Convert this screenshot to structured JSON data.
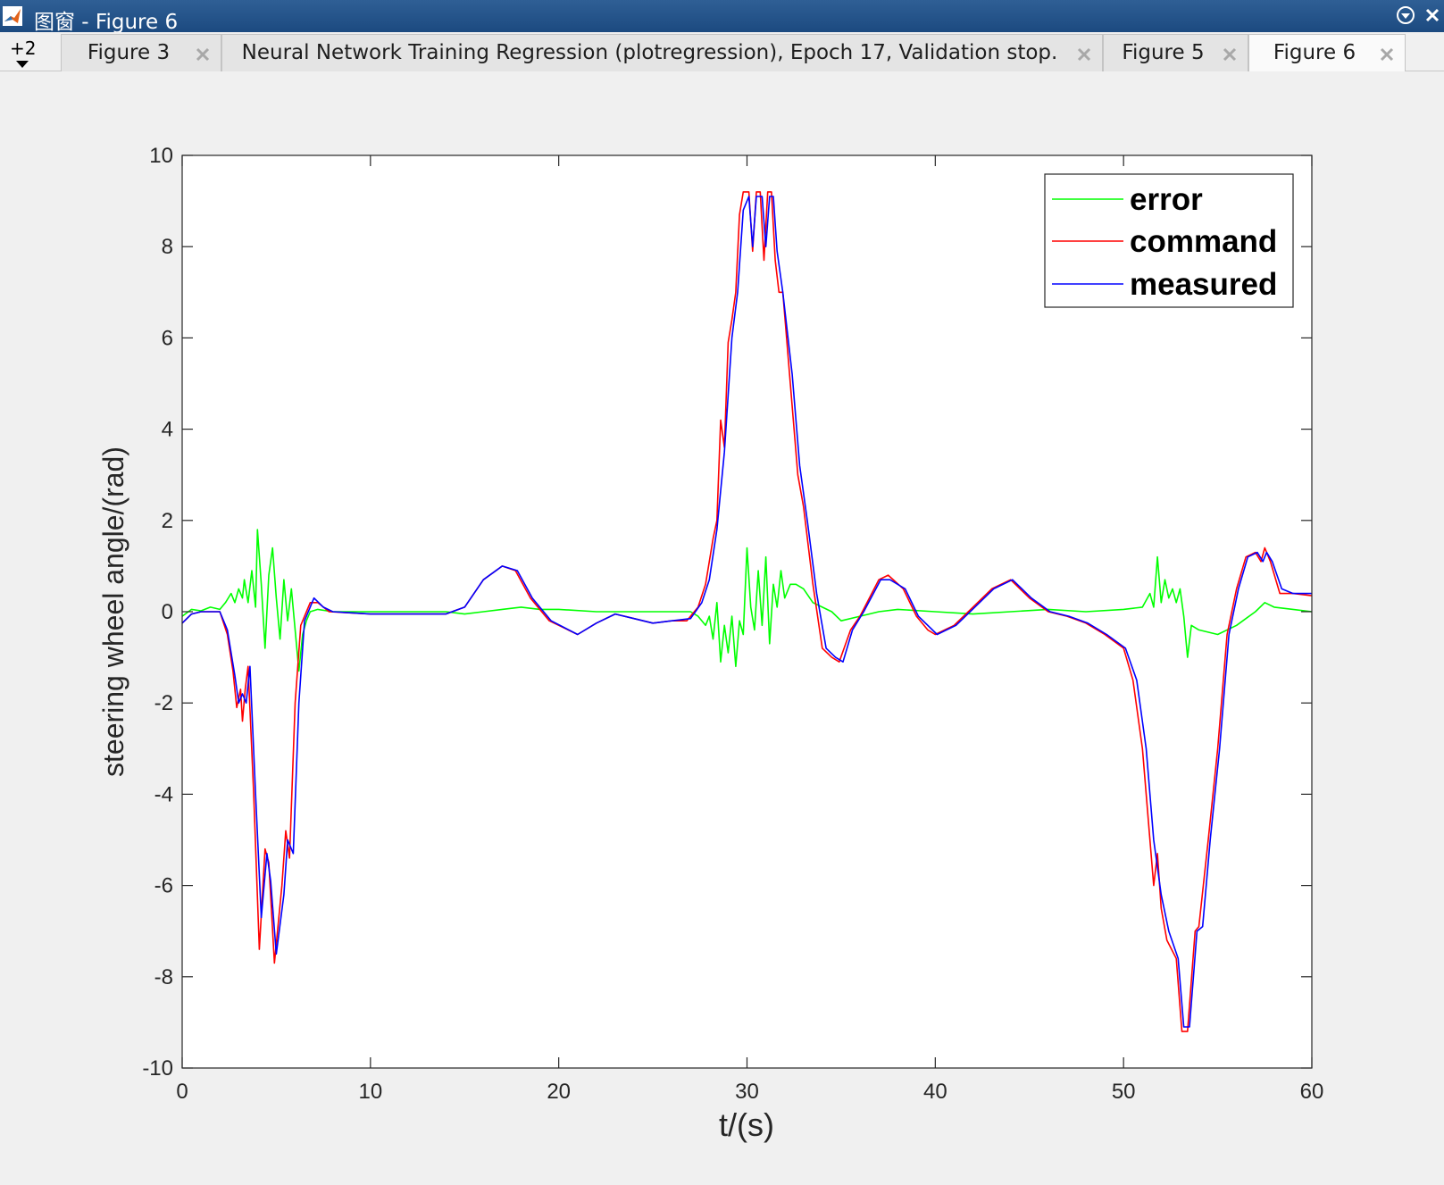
{
  "window": {
    "title": "图窗 - Figure 6",
    "controls": [
      "menu-icon",
      "close-icon"
    ]
  },
  "tabstrip": {
    "overflow_label": "+2",
    "tabs": [
      {
        "label": "Figure 3",
        "active": false
      },
      {
        "label": "Neural Network Training Regression (plotregression), Epoch 17, Validation stop.",
        "active": false
      },
      {
        "label": "Figure 5",
        "active": false
      },
      {
        "label": "Figure 6",
        "active": true
      }
    ]
  },
  "colors": {
    "error": "#00ff00",
    "command": "#ff0000",
    "measured": "#0000ff",
    "titlebar": "#1c4a80",
    "background": "#f0f0f0"
  },
  "chart_data": {
    "type": "line",
    "title": "",
    "xlabel": "t/(s)",
    "ylabel": "steering wheel angle/(rad)",
    "xlim": [
      0,
      60
    ],
    "ylim": [
      -10,
      10
    ],
    "xticks": [
      0,
      10,
      20,
      30,
      40,
      50,
      60
    ],
    "yticks": [
      10,
      8,
      6,
      4,
      2,
      0,
      -2,
      -4,
      -6,
      -8,
      -10
    ],
    "grid": false,
    "legend_position": "top-right",
    "series": [
      {
        "name": "error",
        "color": "#00ff00",
        "points": [
          [
            0,
            -0.1
          ],
          [
            0.5,
            0.05
          ],
          [
            1,
            0.02
          ],
          [
            1.5,
            0.1
          ],
          [
            2,
            0.05
          ],
          [
            2.3,
            0.2
          ],
          [
            2.6,
            0.4
          ],
          [
            2.8,
            0.2
          ],
          [
            3.0,
            0.5
          ],
          [
            3.2,
            0.3
          ],
          [
            3.3,
            0.7
          ],
          [
            3.5,
            0.2
          ],
          [
            3.7,
            0.9
          ],
          [
            3.9,
            0.1
          ],
          [
            4.0,
            1.8
          ],
          [
            4.2,
            0.6
          ],
          [
            4.4,
            -0.8
          ],
          [
            4.6,
            0.8
          ],
          [
            4.8,
            1.4
          ],
          [
            5.0,
            0.3
          ],
          [
            5.2,
            -0.6
          ],
          [
            5.4,
            0.7
          ],
          [
            5.6,
            -0.2
          ],
          [
            5.8,
            0.5
          ],
          [
            6.0,
            -0.4
          ],
          [
            6.2,
            -1.3
          ],
          [
            6.4,
            -0.5
          ],
          [
            6.6,
            -0.2
          ],
          [
            6.8,
            0.0
          ],
          [
            7.2,
            0.05
          ],
          [
            8,
            0.0
          ],
          [
            10,
            0.0
          ],
          [
            12,
            0.0
          ],
          [
            14,
            0.0
          ],
          [
            15,
            -0.05
          ],
          [
            16,
            0.0
          ],
          [
            17,
            0.05
          ],
          [
            18,
            0.1
          ],
          [
            19,
            0.05
          ],
          [
            20,
            0.05
          ],
          [
            22,
            0.0
          ],
          [
            25,
            0.0
          ],
          [
            26,
            0.0
          ],
          [
            27,
            0.0
          ],
          [
            27.4,
            -0.1
          ],
          [
            27.8,
            -0.3
          ],
          [
            28.0,
            -0.1
          ],
          [
            28.2,
            -0.6
          ],
          [
            28.4,
            0.2
          ],
          [
            28.6,
            -1.1
          ],
          [
            28.8,
            -0.3
          ],
          [
            29.0,
            -0.9
          ],
          [
            29.2,
            -0.1
          ],
          [
            29.4,
            -1.2
          ],
          [
            29.6,
            -0.2
          ],
          [
            29.8,
            -0.5
          ],
          [
            30.0,
            1.4
          ],
          [
            30.2,
            0.1
          ],
          [
            30.4,
            -0.4
          ],
          [
            30.6,
            0.9
          ],
          [
            30.8,
            -0.3
          ],
          [
            31.0,
            1.2
          ],
          [
            31.2,
            -0.7
          ],
          [
            31.4,
            0.6
          ],
          [
            31.6,
            0.1
          ],
          [
            31.8,
            0.9
          ],
          [
            32.0,
            0.3
          ],
          [
            32.3,
            0.6
          ],
          [
            32.6,
            0.6
          ],
          [
            33,
            0.5
          ],
          [
            33.5,
            0.2
          ],
          [
            34,
            0.1
          ],
          [
            34.5,
            0.0
          ],
          [
            35,
            -0.2
          ],
          [
            36,
            -0.1
          ],
          [
            37,
            0.0
          ],
          [
            38,
            0.05
          ],
          [
            40,
            0.0
          ],
          [
            42,
            -0.05
          ],
          [
            44,
            0.0
          ],
          [
            46,
            0.05
          ],
          [
            48,
            0.0
          ],
          [
            50,
            0.05
          ],
          [
            51,
            0.1
          ],
          [
            51.4,
            0.4
          ],
          [
            51.6,
            0.1
          ],
          [
            51.8,
            1.2
          ],
          [
            52.0,
            0.2
          ],
          [
            52.2,
            0.7
          ],
          [
            52.4,
            0.3
          ],
          [
            52.6,
            0.5
          ],
          [
            52.8,
            0.2
          ],
          [
            53.0,
            0.5
          ],
          [
            53.2,
            -0.1
          ],
          [
            53.4,
            -1.0
          ],
          [
            53.6,
            -0.3
          ],
          [
            54,
            -0.4
          ],
          [
            55,
            -0.5
          ],
          [
            56,
            -0.3
          ],
          [
            57,
            0.0
          ],
          [
            57.5,
            0.2
          ],
          [
            58,
            0.1
          ],
          [
            59,
            0.05
          ],
          [
            60,
            0.0
          ]
        ]
      },
      {
        "name": "command",
        "color": "#ff0000",
        "points": [
          [
            0,
            -0.25
          ],
          [
            0.5,
            -0.05
          ],
          [
            1,
            0.0
          ],
          [
            2,
            0.0
          ],
          [
            2.4,
            -0.5
          ],
          [
            2.7,
            -1.3
          ],
          [
            2.9,
            -2.1
          ],
          [
            3.1,
            -1.7
          ],
          [
            3.2,
            -2.4
          ],
          [
            3.35,
            -1.7
          ],
          [
            3.5,
            -1.2
          ],
          [
            3.8,
            -4.0
          ],
          [
            4.1,
            -7.4
          ],
          [
            4.4,
            -5.2
          ],
          [
            4.6,
            -5.5
          ],
          [
            4.9,
            -7.7
          ],
          [
            5.3,
            -6.0
          ],
          [
            5.5,
            -4.8
          ],
          [
            5.7,
            -5.4
          ],
          [
            6.0,
            -2.0
          ],
          [
            6.3,
            -0.3
          ],
          [
            6.8,
            0.2
          ],
          [
            7.2,
            0.2
          ],
          [
            7.8,
            0.0
          ],
          [
            10,
            -0.05
          ],
          [
            12,
            -0.05
          ],
          [
            14,
            -0.05
          ],
          [
            15,
            0.1
          ],
          [
            16,
            0.7
          ],
          [
            17,
            1.0
          ],
          [
            17.7,
            0.9
          ],
          [
            18.5,
            0.3
          ],
          [
            19.5,
            -0.2
          ],
          [
            21,
            -0.5
          ],
          [
            22,
            -0.25
          ],
          [
            23,
            -0.05
          ],
          [
            24,
            -0.15
          ],
          [
            25,
            -0.25
          ],
          [
            26,
            -0.2
          ],
          [
            26.8,
            -0.2
          ],
          [
            27.4,
            0.1
          ],
          [
            27.8,
            0.6
          ],
          [
            28.2,
            1.6
          ],
          [
            28.4,
            2.0
          ],
          [
            28.6,
            4.2
          ],
          [
            28.8,
            3.6
          ],
          [
            29.0,
            5.9
          ],
          [
            29.2,
            6.4
          ],
          [
            29.4,
            7.0
          ],
          [
            29.6,
            8.7
          ],
          [
            29.8,
            9.2
          ],
          [
            30.1,
            9.2
          ],
          [
            30.3,
            7.9
          ],
          [
            30.5,
            9.2
          ],
          [
            30.7,
            9.2
          ],
          [
            30.9,
            7.7
          ],
          [
            31.1,
            9.2
          ],
          [
            31.3,
            9.2
          ],
          [
            31.5,
            7.7
          ],
          [
            31.7,
            7.0
          ],
          [
            31.9,
            7.0
          ],
          [
            32.3,
            5.0
          ],
          [
            32.7,
            3.0
          ],
          [
            33.0,
            2.3
          ],
          [
            33.5,
            0.6
          ],
          [
            34.0,
            -0.8
          ],
          [
            34.5,
            -1.0
          ],
          [
            34.9,
            -1.1
          ],
          [
            35.5,
            -0.4
          ],
          [
            36,
            -0.1
          ],
          [
            37,
            0.7
          ],
          [
            37.5,
            0.8
          ],
          [
            38.3,
            0.5
          ],
          [
            39,
            -0.1
          ],
          [
            39.6,
            -0.4
          ],
          [
            40,
            -0.5
          ],
          [
            41,
            -0.3
          ],
          [
            42,
            0.1
          ],
          [
            43,
            0.5
          ],
          [
            44,
            0.7
          ],
          [
            45,
            0.3
          ],
          [
            46,
            0.0
          ],
          [
            47,
            -0.1
          ],
          [
            48,
            -0.25
          ],
          [
            49,
            -0.5
          ],
          [
            50,
            -0.8
          ],
          [
            50.5,
            -1.5
          ],
          [
            51,
            -3.0
          ],
          [
            51.4,
            -5.0
          ],
          [
            51.6,
            -6.0
          ],
          [
            51.8,
            -5.3
          ],
          [
            52.0,
            -6.5
          ],
          [
            52.3,
            -7.2
          ],
          [
            52.8,
            -7.6
          ],
          [
            53.1,
            -9.2
          ],
          [
            53.4,
            -9.2
          ],
          [
            53.8,
            -7.0
          ],
          [
            54,
            -6.9
          ],
          [
            54.5,
            -5.0
          ],
          [
            55,
            -3.0
          ],
          [
            55.5,
            -0.5
          ],
          [
            56,
            0.5
          ],
          [
            56.5,
            1.2
          ],
          [
            57,
            1.3
          ],
          [
            57.3,
            1.1
          ],
          [
            57.5,
            1.4
          ],
          [
            57.8,
            1.1
          ],
          [
            58.3,
            0.4
          ],
          [
            59,
            0.4
          ],
          [
            60,
            0.35
          ]
        ]
      },
      {
        "name": "measured",
        "color": "#0000ff",
        "points": [
          [
            0,
            -0.25
          ],
          [
            0.5,
            -0.05
          ],
          [
            1,
            0.0
          ],
          [
            2,
            0.0
          ],
          [
            2.4,
            -0.4
          ],
          [
            2.8,
            -1.4
          ],
          [
            3.0,
            -2.0
          ],
          [
            3.2,
            -1.8
          ],
          [
            3.4,
            -2.0
          ],
          [
            3.6,
            -1.2
          ],
          [
            3.9,
            -4.0
          ],
          [
            4.2,
            -6.7
          ],
          [
            4.5,
            -5.3
          ],
          [
            4.7,
            -5.9
          ],
          [
            5.0,
            -7.5
          ],
          [
            5.4,
            -6.2
          ],
          [
            5.6,
            -5.0
          ],
          [
            5.9,
            -5.3
          ],
          [
            6.2,
            -2.0
          ],
          [
            6.5,
            -0.2
          ],
          [
            7.0,
            0.3
          ],
          [
            7.5,
            0.1
          ],
          [
            8,
            0.0
          ],
          [
            10,
            -0.05
          ],
          [
            14,
            -0.05
          ],
          [
            15,
            0.1
          ],
          [
            16,
            0.7
          ],
          [
            17,
            1.0
          ],
          [
            17.8,
            0.9
          ],
          [
            18.6,
            0.3
          ],
          [
            19.6,
            -0.2
          ],
          [
            21,
            -0.5
          ],
          [
            22,
            -0.25
          ],
          [
            23,
            -0.05
          ],
          [
            24,
            -0.15
          ],
          [
            25,
            -0.25
          ],
          [
            26,
            -0.2
          ],
          [
            27,
            -0.15
          ],
          [
            27.6,
            0.2
          ],
          [
            28.0,
            0.7
          ],
          [
            28.4,
            1.8
          ],
          [
            28.8,
            3.5
          ],
          [
            29.2,
            6.0
          ],
          [
            29.5,
            7.0
          ],
          [
            29.8,
            8.8
          ],
          [
            30.1,
            9.1
          ],
          [
            30.3,
            8.0
          ],
          [
            30.5,
            9.1
          ],
          [
            30.8,
            9.1
          ],
          [
            31.0,
            8.0
          ],
          [
            31.2,
            9.1
          ],
          [
            31.4,
            9.1
          ],
          [
            31.6,
            7.9
          ],
          [
            31.9,
            7.0
          ],
          [
            32.4,
            5.2
          ],
          [
            32.8,
            3.2
          ],
          [
            33.2,
            2.0
          ],
          [
            33.7,
            0.4
          ],
          [
            34.2,
            -0.8
          ],
          [
            34.7,
            -1.0
          ],
          [
            35.1,
            -1.1
          ],
          [
            35.6,
            -0.4
          ],
          [
            36.2,
            0.0
          ],
          [
            37.1,
            0.7
          ],
          [
            37.6,
            0.7
          ],
          [
            38.4,
            0.5
          ],
          [
            39.1,
            -0.1
          ],
          [
            40.1,
            -0.5
          ],
          [
            41.1,
            -0.3
          ],
          [
            42.1,
            0.1
          ],
          [
            43.1,
            0.5
          ],
          [
            44.1,
            0.7
          ],
          [
            45.1,
            0.3
          ],
          [
            46.1,
            0.0
          ],
          [
            47.1,
            -0.1
          ],
          [
            48.1,
            -0.25
          ],
          [
            49.1,
            -0.5
          ],
          [
            50.1,
            -0.8
          ],
          [
            50.7,
            -1.5
          ],
          [
            51.2,
            -3.0
          ],
          [
            51.6,
            -5.0
          ],
          [
            52.0,
            -6.2
          ],
          [
            52.4,
            -7.0
          ],
          [
            52.9,
            -7.6
          ],
          [
            53.2,
            -9.1
          ],
          [
            53.5,
            -9.1
          ],
          [
            53.9,
            -7.0
          ],
          [
            54.2,
            -6.9
          ],
          [
            54.6,
            -5.0
          ],
          [
            55.1,
            -3.0
          ],
          [
            55.6,
            -0.5
          ],
          [
            56.1,
            0.5
          ],
          [
            56.6,
            1.2
          ],
          [
            57.1,
            1.3
          ],
          [
            57.4,
            1.1
          ],
          [
            57.6,
            1.3
          ],
          [
            57.9,
            1.1
          ],
          [
            58.4,
            0.5
          ],
          [
            59,
            0.4
          ],
          [
            60,
            0.4
          ]
        ]
      }
    ]
  }
}
